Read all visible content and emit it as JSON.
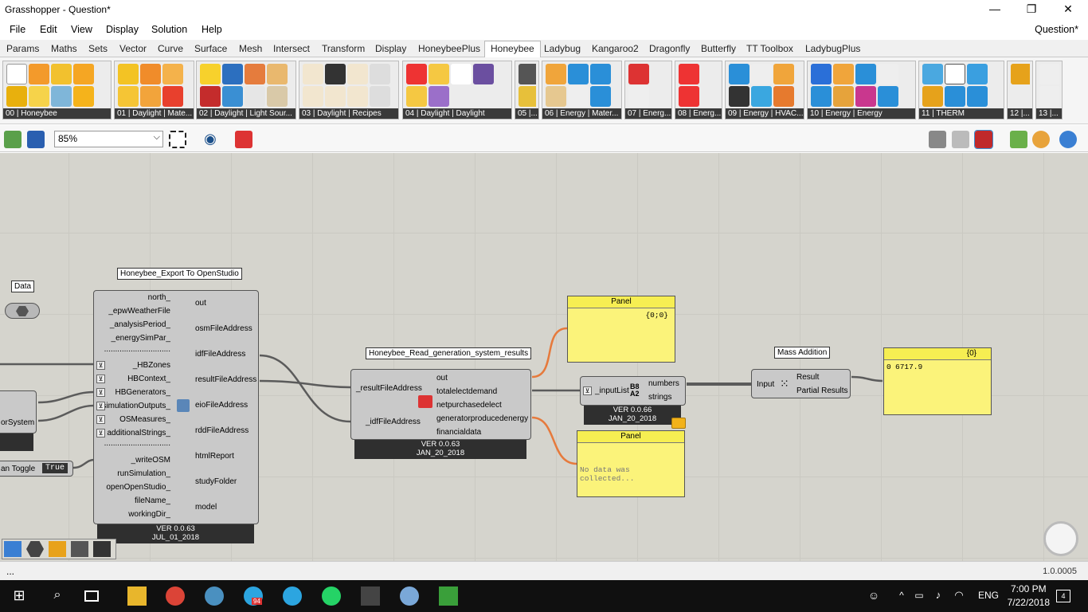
{
  "window": {
    "title": "Grasshopper - Question*",
    "minimize": "—",
    "maximize": "❐",
    "close": "✕"
  },
  "menu": {
    "items": [
      "File",
      "Edit",
      "View",
      "Display",
      "Solution",
      "Help"
    ],
    "document": "Question*"
  },
  "tabs": [
    "Params",
    "Maths",
    "Sets",
    "Vector",
    "Curve",
    "Surface",
    "Mesh",
    "Intersect",
    "Transform",
    "Display",
    "HoneybeePlus",
    "Honeybee",
    "Ladybug",
    "Kangaroo2",
    "Dragonfly",
    "Butterfly",
    "TT Toolbox",
    "LadybugPlus"
  ],
  "active_tab": "Honeybee",
  "ribbon_groups": [
    "00 | Honeybee",
    "01 | Daylight | Mate...",
    "02 | Daylight | Light Sour...",
    "03 | Daylight | Recipes",
    "04 | Daylight | Daylight",
    "05 |...",
    "06 | Energy | Mater...",
    "07 | Energ...",
    "08 | Energ...",
    "09 | Energy | HVAC...",
    "10 | Energy | Energy",
    "11 | THERM",
    "12 |...",
    "13 |..."
  ],
  "toolbar": {
    "zoom": "85%"
  },
  "canvas": {
    "data_param": {
      "title": "Data"
    },
    "export": {
      "title": "Honeybee_Export To OpenStudio",
      "inputs": [
        "north_",
        "_epwWeatherFile",
        "_analysisPeriod_",
        "_energySimPar_",
        "..............................",
        "_HBZones",
        "HBContext_",
        "HBGenerators_",
        "simulationOutputs_",
        "OSMeasures_",
        "additionalStrings_",
        "..............................",
        "_writeOSM",
        "runSimulation_",
        "openOpenStudio_",
        "fileName_",
        "workingDir_"
      ],
      "outputs": [
        "out",
        "osmFileAddress",
        "idfFileAddress",
        "resultFileAddress",
        "eioFileAddress",
        "rddFileAddress",
        "htmlReport",
        "studyFolder",
        "model"
      ],
      "version": "VER 0.0.63",
      "date": "JUL_01_2018"
    },
    "partial_left": {
      "label": "orSystem"
    },
    "toggle": {
      "label": "an Toggle",
      "value": "True"
    },
    "read_results": {
      "title": "Honeybee_Read_generation_system_results",
      "inputs": [
        "_resultFileAddress",
        "_idfFileAddress"
      ],
      "outputs": [
        "out",
        "totalelectdemand",
        "netpurchasedelect",
        "generatorproducedenergy",
        "financialdata"
      ],
      "version": "VER 0.0.63",
      "date": "JAN_20_2018"
    },
    "panel_top": {
      "title": "Panel",
      "path": "{0;0}"
    },
    "panel_bottom": {
      "title": "Panel",
      "text": "No data was collected..."
    },
    "input_list": {
      "input": "_inputList",
      "outputs": [
        "numbers",
        "strings"
      ],
      "version": "VER 0.0.66",
      "date": "JAN_20_2018"
    },
    "mass_addition": {
      "title": "Mass Addition",
      "input": "Input",
      "outputs": [
        "Result",
        "Partial Results"
      ]
    },
    "panel_result": {
      "path": "{0}",
      "index": "0",
      "value": "6717.9"
    }
  },
  "status": {
    "left": "...",
    "right": "1.0.0005"
  },
  "taskbar": {
    "time": "7:00 PM",
    "date": "7/22/2018",
    "lang": "ENG",
    "badge": "94",
    "notif": "4"
  }
}
